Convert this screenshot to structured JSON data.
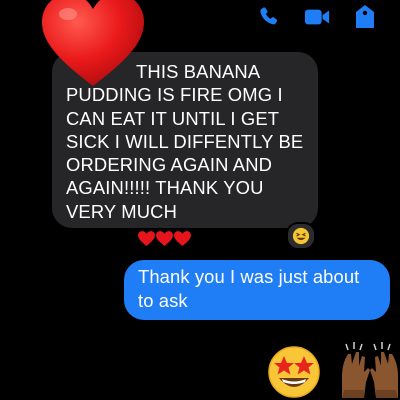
{
  "header": {
    "icons": [
      "phone-icon",
      "video-camera-icon",
      "info-tag-icon"
    ]
  },
  "colors": {
    "background": "#000000",
    "incoming_bubble": "#262628",
    "outgoing_bubble": "#1f7ef6",
    "accent": "#1f7ef6",
    "heart_red": "#e8141b"
  },
  "messages": {
    "incoming": {
      "text": "THIS BANANA PUDDING IS FIRE OMG I CAN EAT IT UNTIL I GET SICK I WILL DIFFENTLY BE ORDERING AGAIN AND AGAIN!!!!! THANK YOU VERY MUCH",
      "trailing_emoji": [
        "red-heart",
        "red-heart",
        "red-heart"
      ],
      "reaction_above": "red-heart",
      "reaction_badge": "grinning-squinting-face"
    },
    "outgoing": {
      "text": "Thank you I was just about to ask"
    },
    "emoji_message": [
      "star-struck-face",
      "raising-hands-dark-skin-tone"
    ]
  }
}
